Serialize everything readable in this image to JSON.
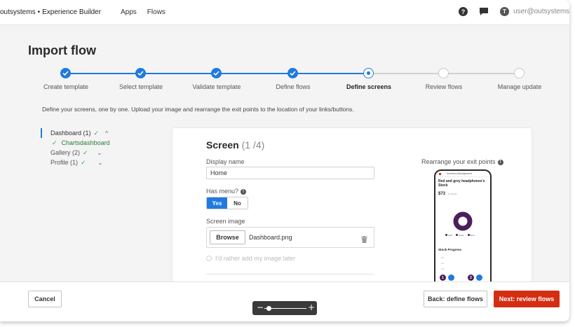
{
  "header": {
    "brand": "outsystems",
    "brand_separator": "•",
    "product": "Experience Builder",
    "nav": [
      "Apps",
      "Flows"
    ],
    "user": "user@outsystems.c",
    "avatar_initial": "T"
  },
  "page": {
    "title": "Import flow",
    "instructions": "Define your screens, one by one. Upload your image and rearrange the exit points to the location of your links/buttons."
  },
  "stepper": {
    "steps": [
      {
        "label": "Create template",
        "state": "done"
      },
      {
        "label": "Select template",
        "state": "done"
      },
      {
        "label": "Validate template",
        "state": "done"
      },
      {
        "label": "Define flows",
        "state": "done"
      },
      {
        "label": "Define screens",
        "state": "current"
      },
      {
        "label": "Review flows",
        "state": "todo"
      },
      {
        "label": "Manage update",
        "state": "todo"
      }
    ]
  },
  "tree": {
    "groups": [
      {
        "label": "Dashboard (1)",
        "check": "✓",
        "chevron": "^"
      },
      {
        "label": "Gallery (2)",
        "check": "✓",
        "chevron": "⌄"
      },
      {
        "label": "Profile (1)",
        "check": "✓",
        "chevron": "⌄"
      }
    ],
    "selected_screen": "Chartsdashboard",
    "selected_check": "✓"
  },
  "form": {
    "heading": "Screen",
    "count": "(1 /4)",
    "display_name_label": "Display name",
    "display_name_value": "Home",
    "has_menu_label": "Has menu?",
    "yes_label": "Yes",
    "no_label": "No",
    "screen_image_label": "Screen image",
    "browse_label": "Browse",
    "file_name": "Dashboard.png",
    "later_label": "I'd rather add my image later"
  },
  "preview": {
    "label": "Rearrange your exit points",
    "app_name": "Inventory Management",
    "product_title": "Red and grey headphones's Stock",
    "price": "$73",
    "price_note": "(in Stock)",
    "legend": [
      "Sold",
      "Stock",
      "Brok"
    ],
    "stock_progress": "Stock Progress",
    "axis": [
      "5%",
      "4%",
      "2%"
    ],
    "exit_points": [
      "1",
      "2"
    ]
  },
  "footer": {
    "cancel": "Cancel",
    "back": "Back: define flows",
    "next": "Next: review flows"
  },
  "zoom": {
    "minus": "−",
    "plus": "+",
    "level": 0.1
  },
  "colors": {
    "primary": "#1f7ae0",
    "danger": "#d42e12",
    "success": "#3fa34d"
  }
}
